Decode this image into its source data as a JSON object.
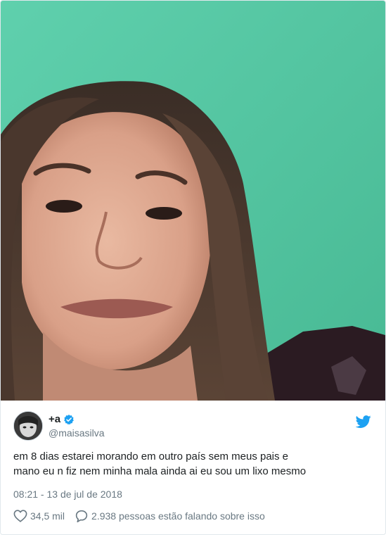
{
  "tweet": {
    "display_name": "+a",
    "handle": "@maisasilva",
    "text_lines": [
      "em 8 dias estarei morando em outro país sem meus pais e",
      "mano eu n fiz nem minha mala ainda ai eu sou um lixo mesmo"
    ],
    "timestamp": "08:21 - 13 de jul de 2018",
    "likes": "34,5 mil",
    "replies": "2.938 pessoas estão falando sobre isso"
  },
  "icons": {
    "verified": "verified-badge-icon",
    "bird": "twitter-bird-icon",
    "like": "heart-icon",
    "reply": "speech-bubble-icon"
  },
  "colors": {
    "brand": "#1da1f2",
    "muted_text": "#697882",
    "wall": "#56c9a6"
  }
}
